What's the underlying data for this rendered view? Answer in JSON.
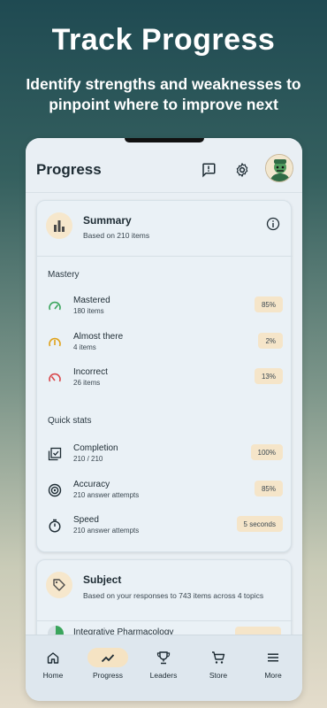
{
  "hero": {
    "title": "Track Progress",
    "subtitle": "Identify strengths and weaknesses to pinpoint where to improve next"
  },
  "header": {
    "title": "Progress",
    "icons": [
      "feedback-icon",
      "gear-icon",
      "avatar"
    ]
  },
  "summary": {
    "title": "Summary",
    "subtitle": "Based on 210 items",
    "mastery_label": "Mastery",
    "mastery": [
      {
        "label": "Mastered",
        "sub": "180 items",
        "value": "85%",
        "icon": "gauge-high-icon",
        "color": "#3aa55c"
      },
      {
        "label": "Almost there",
        "sub": "4 items",
        "value": "2%",
        "icon": "gauge-mid-icon",
        "color": "#e0a21a"
      },
      {
        "label": "Incorrect",
        "sub": "26 items",
        "value": "13%",
        "icon": "gauge-low-icon",
        "color": "#d9474b"
      }
    ],
    "quick_stats_label": "Quick stats",
    "quick_stats": [
      {
        "label": "Completion",
        "sub": "210 / 210",
        "value": "100%",
        "icon": "checklist-icon"
      },
      {
        "label": "Accuracy",
        "sub": "210 answer attempts",
        "value": "85%",
        "icon": "target-icon"
      },
      {
        "label": "Speed",
        "sub": "210 answer attempts",
        "value": "5 seconds",
        "icon": "timer-icon"
      }
    ]
  },
  "subject": {
    "title": "Subject",
    "subtitle": "Based on your responses to 743 items across 4 topics",
    "partial_row_label": "Integrative Pharmacology"
  },
  "nav": [
    {
      "label": "Home",
      "icon": "home-icon",
      "active": false
    },
    {
      "label": "Progress",
      "icon": "trend-icon",
      "active": true
    },
    {
      "label": "Leaders",
      "icon": "trophy-icon",
      "active": false
    },
    {
      "label": "Store",
      "icon": "cart-icon",
      "active": false
    },
    {
      "label": "More",
      "icon": "menu-icon",
      "active": false
    }
  ],
  "colors": {
    "accent": "#f5e3c3",
    "mastered": "#3aa55c",
    "almost": "#e0a21a",
    "incorrect": "#d9474b"
  }
}
